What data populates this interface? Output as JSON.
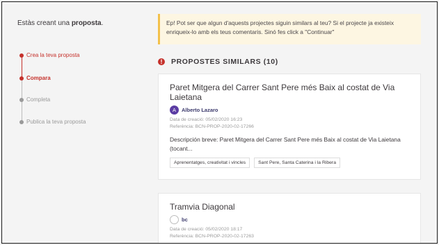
{
  "sidebar": {
    "intro_prefix": "Estàs creant una ",
    "intro_bold": "proposta",
    "intro_suffix": ".",
    "steps": [
      {
        "label": "Crea la teva proposta",
        "state": "done"
      },
      {
        "label": "Compara",
        "state": "active"
      },
      {
        "label": "Completa",
        "state": "todo"
      },
      {
        "label": "Publica la teva proposta",
        "state": "todo"
      }
    ]
  },
  "notice": {
    "text": "Ep! Pot ser que algun d'aquests projectes siguin similars al teu? Si el projecte ja existeix enriqueix-lo amb els teus comentaris. Sinó fes click a \"Continuar\""
  },
  "section": {
    "title": "PROPOSTES SIMILARS (10)",
    "icon": "alert-circle-icon"
  },
  "proposals": [
    {
      "title": "Paret Mitgera del Carrer Sant Pere més Baix al costat de Via Laietana",
      "author_initial": "A",
      "author": "Alberto Lazaro",
      "date": "Data de creació: 05/02/2020 16:23",
      "reference": "Referència: BCN-PROP-2020-02-17266",
      "description": "Descripción breve: Paret Mitgera del Carrer Sant Pere més Baix al costat de Via Laietana (tocant...",
      "tags": [
        "Aprenentatges, creativitat i vincles",
        "Sant Pere, Santa Caterina i la Ribera"
      ]
    },
    {
      "title": "Tramvia Diagonal",
      "author_initial": "",
      "author": "bc",
      "date": "Data de creació: 05/02/2020 18:17",
      "reference": "Referència: BCN-PROP-2020-02-17263"
    }
  ],
  "colors": {
    "accent": "#c5312b",
    "notice_bg": "#fdf6e2",
    "notice_border": "#f3c14b",
    "author": "#3d3b6d"
  }
}
